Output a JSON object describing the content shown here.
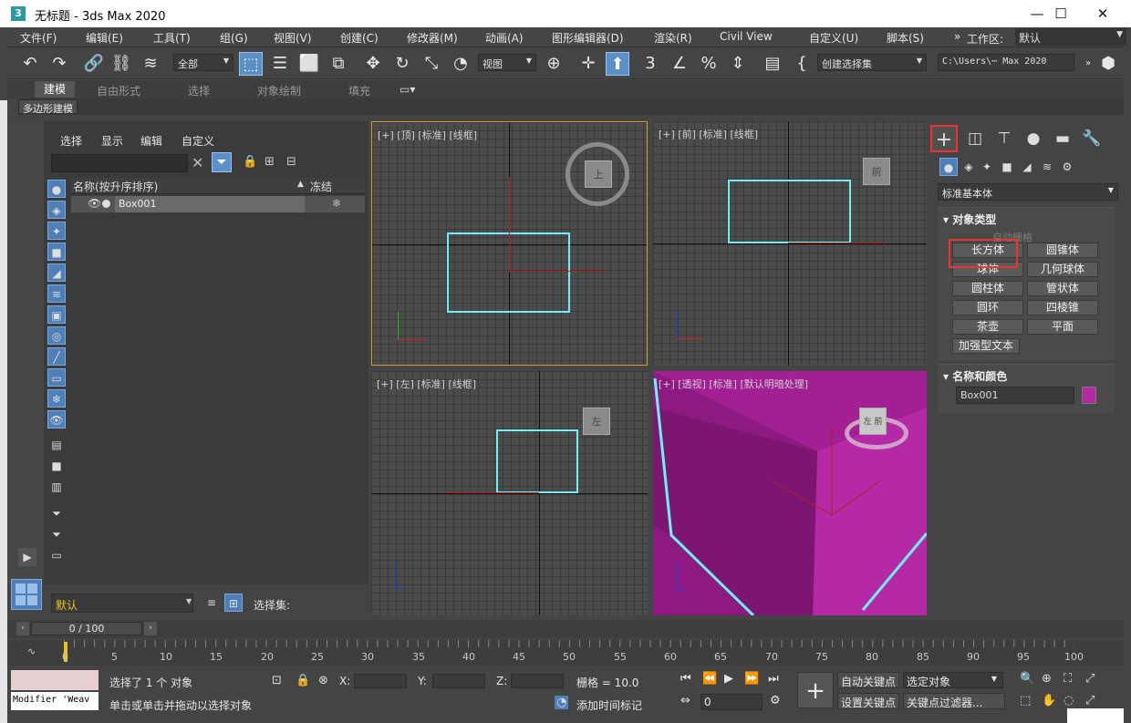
{
  "window": {
    "title": "无标题 - 3ds Max 2020",
    "app_icon": "3",
    "minimize": "—",
    "maximize": "☐",
    "close": "✕"
  },
  "menu": {
    "items": [
      "文件(F)",
      "编辑(E)",
      "工具(T)",
      "组(G)",
      "视图(V)",
      "创建(C)",
      "修改器(M)",
      "动画(A)",
      "图形编辑器(D)",
      "渲染(R)",
      "Civil View",
      "自定义(U)",
      "脚本(S)"
    ],
    "overflow": "»",
    "workspace_label": "工作区:",
    "workspace_value": "默认"
  },
  "toolbar": {
    "selection_filter": "全部",
    "ref_coord": "视图",
    "named_selection": "创建选择集",
    "path": "C:\\Users\\⋯ Max 2020",
    "snap_3": "3"
  },
  "ribbon": {
    "tabs": [
      "建模",
      "自由形式",
      "选择",
      "对象绘制",
      "填充"
    ],
    "active": "建模",
    "sub_tag": "多边形建模"
  },
  "explorer": {
    "menus": [
      "选择",
      "显示",
      "编辑",
      "自定义"
    ],
    "col_name": "名称(按升序排序)",
    "sort_arrow": "▲",
    "col_freeze": "冻结",
    "row_name": "Box001",
    "layer": "默认",
    "selset_label": "选择集:",
    "clear_glyph": "✕"
  },
  "viewports": {
    "top": {
      "label": "[+] [顶] [标准] [线框]",
      "cube": "上"
    },
    "front": {
      "label": "[+] [前] [标准] [线框]",
      "cube": "前"
    },
    "left": {
      "label": "[+] [左] [标准] [线框]",
      "cube": "左"
    },
    "persp": {
      "label": "[+] [透视] [标准] [默认明暗处理]",
      "cube": "左 前"
    }
  },
  "command_panel": {
    "category": "标准基本体",
    "rollout_object_type": "对象类型",
    "autogrid": "自动栅格",
    "buttons": [
      "长方体",
      "圆锥体",
      "球体",
      "几何球体",
      "圆柱体",
      "管状体",
      "圆环",
      "四棱锥",
      "茶壶",
      "平面",
      "加强型文本"
    ],
    "rollout_name_color": "名称和颜色",
    "object_name": "Box001",
    "object_color": "#b629a6"
  },
  "timeline": {
    "frame_display": "0 / 100",
    "ticks": [
      "0",
      "5",
      "10",
      "15",
      "20",
      "25",
      "30",
      "35",
      "40",
      "45",
      "50",
      "55",
      "60",
      "65",
      "70",
      "75",
      "80",
      "85",
      "90",
      "95",
      "100"
    ]
  },
  "status": {
    "maxscript": "Modifier 'Weav",
    "selected": "选择了 1 个 对象",
    "prompt": "单击或单击并拖动以选择对象",
    "x_label": "X:",
    "y_label": "Y:",
    "z_label": "Z:",
    "grid": "栅格 = 10.0",
    "add_time_tag": "添加时间标记",
    "auto_key": "自动关键点",
    "selected_obj": "选定对象",
    "set_key": "设置关键点",
    "key_filter": "关键点过滤器...",
    "frame": "0"
  },
  "colors": {
    "accent": "#5a8fc8",
    "highlight_red": "#e33333",
    "box_wire": "#6ef0f4",
    "persp_object": "#b629a6"
  }
}
